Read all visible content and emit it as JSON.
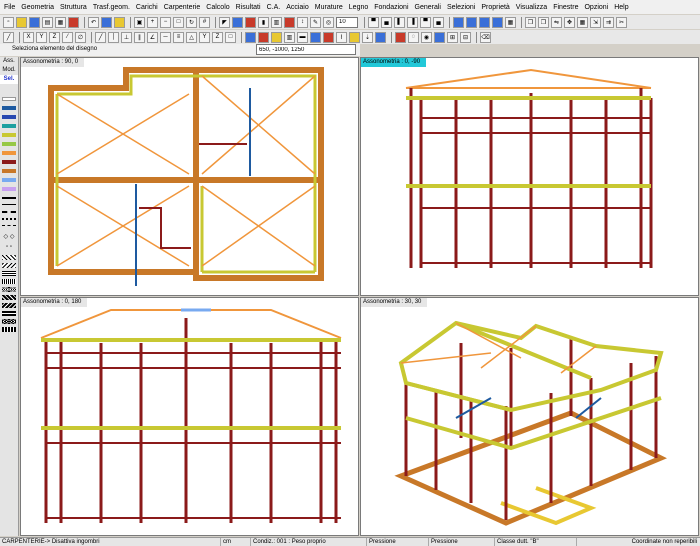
{
  "menu": [
    "File",
    "Geometria",
    "Struttura",
    "Trasf.geom.",
    "Carichi",
    "Carpenterie",
    "Calcolo",
    "Risultati",
    "C.A.",
    "Acciaio",
    "Murature",
    "Legno",
    "Fondazioni",
    "Generali",
    "Selezioni",
    "Proprietà",
    "Visualizza",
    "Finestre",
    "Opzioni",
    "Help"
  ],
  "toolbar": {
    "layer_value": "10"
  },
  "infobar": {
    "prompt": "Seleziona  elemento del disegno",
    "coords": "650, -1000, 1250"
  },
  "side_panel": {
    "tabs": [
      "Ass.",
      "Mod.",
      "Sel."
    ]
  },
  "viewports": [
    {
      "label": "Assonometria :  90, 0",
      "active": false
    },
    {
      "label": "Assonometria :  0, -90",
      "active": true
    },
    {
      "label": "Assonometria :  0, 180",
      "active": false
    },
    {
      "label": "Assonometria :  30, 30",
      "active": false
    }
  ],
  "status": {
    "mode": "CARPENTERIE-> Disattiva ingombri",
    "units": "cm",
    "load_condition": "Condiz.: 001 : Peso proprio",
    "cell4": "Pressione",
    "cell5": "Pressione",
    "ductility": "Classe dutt. \"B\"",
    "coords_note": "Coordinate non reperibili"
  },
  "colors": {
    "beam_yellow": "#c8c832",
    "column_red": "#8b1a1a",
    "roof_orange": "#f0963c",
    "wall_brown": "#c87828",
    "steel_blue": "#1e5aa0",
    "active_label": "#22c8d8"
  }
}
